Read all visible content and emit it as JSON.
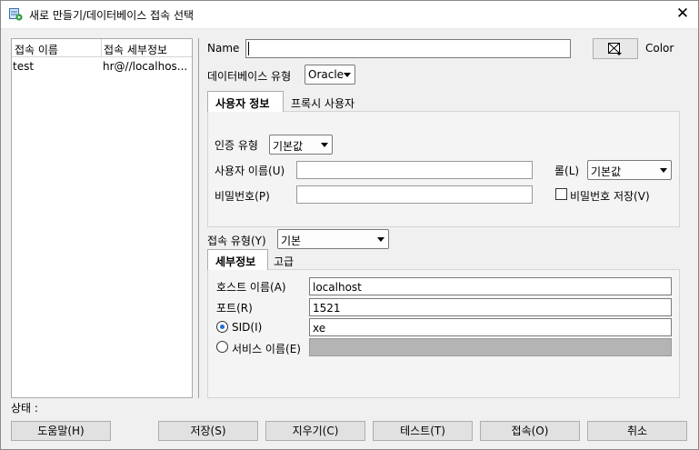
{
  "window": {
    "title": "새로 만들기/데이터베이스 접속 선택",
    "close_glyph": "✕"
  },
  "connections": {
    "columns": [
      "접속 이름",
      "접속 세부정보"
    ],
    "rows": [
      {
        "name": "test",
        "detail": "hr@//localhos..."
      }
    ]
  },
  "form": {
    "name_label": "Name",
    "name_value": "",
    "color_label": "Color",
    "db_type_label": "데이터베이스 유형",
    "db_type_value": "Oracle",
    "tabs": [
      "사용자 정보",
      "프록시 사용자"
    ],
    "auth_type_label": "인증 유형",
    "auth_type_value": "기본값",
    "username_label": "사용자 이름(U)",
    "username_value": "",
    "role_label": "롤(L)",
    "role_value": "기본값",
    "password_label": "비밀번호(P)",
    "password_value": "",
    "save_password_label": "비밀번호 저장(V)",
    "conn_type_label": "접속 유형(Y)",
    "conn_type_value": "기본",
    "detail_tabs": [
      "세부정보",
      "고급"
    ],
    "hostname_label": "호스트 이름(A)",
    "hostname_value": "localhost",
    "port_label": "포트(R)",
    "port_value": "1521",
    "sid_label": "SID(I)",
    "sid_value": "xe",
    "service_label": "서비스 이름(E)",
    "service_value": ""
  },
  "status": {
    "label": "상태 :"
  },
  "buttons": {
    "help": "도움말(H)",
    "save": "저장(S)",
    "clear": "지우기(C)",
    "test": "테스트(T)",
    "connect": "접속(O)",
    "cancel": "취소"
  },
  "colors": {
    "accent": "#1f6fd6",
    "disabled_field": "#b4b4b4"
  }
}
